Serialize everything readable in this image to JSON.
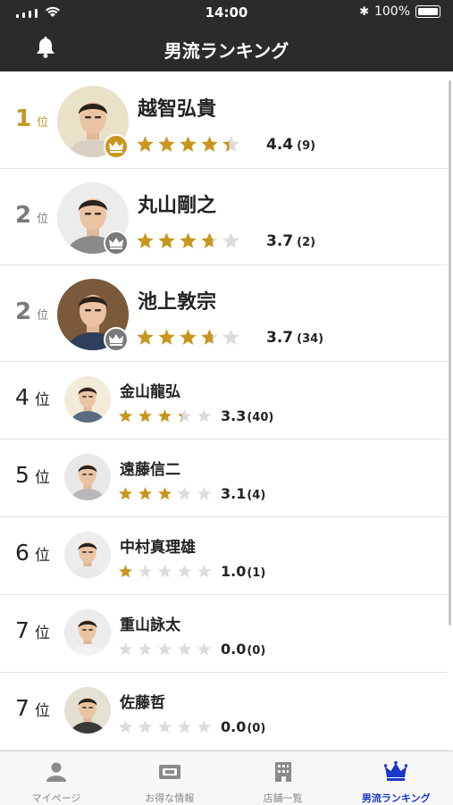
{
  "status": {
    "time": "14:00",
    "battery": "100%"
  },
  "header": {
    "title": "男流ランキング"
  },
  "rankings": [
    {
      "rank": "1",
      "unit": "位",
      "name": "越智弘貴",
      "rating": 4.4,
      "score": "4.4",
      "count": "(9)",
      "crown": "gold"
    },
    {
      "rank": "2",
      "unit": "位",
      "name": "丸山剛之",
      "rating": 3.7,
      "score": "3.7",
      "count": "(2)",
      "crown": "gray"
    },
    {
      "rank": "2",
      "unit": "位",
      "name": "池上敦宗",
      "rating": 3.7,
      "score": "3.7",
      "count": "(34)",
      "crown": "gray"
    },
    {
      "rank": "4",
      "unit": "位",
      "name": "金山龍弘",
      "rating": 3.3,
      "score": "3.3",
      "count": "(40)"
    },
    {
      "rank": "5",
      "unit": "位",
      "name": "遠藤信二",
      "rating": 3.1,
      "score": "3.1",
      "count": "(4)"
    },
    {
      "rank": "6",
      "unit": "位",
      "name": "中村真理雄",
      "rating": 1.0,
      "score": "1.0",
      "count": "(1)"
    },
    {
      "rank": "7",
      "unit": "位",
      "name": "重山詠太",
      "rating": 0.0,
      "score": "0.0",
      "count": "(0)"
    },
    {
      "rank": "7",
      "unit": "位",
      "name": "佐藤哲",
      "rating": 0.0,
      "score": "0.0",
      "count": "(0)"
    }
  ],
  "tabs": [
    {
      "label": "マイページ",
      "icon": "person-icon"
    },
    {
      "label": "お得な情報",
      "icon": "ticket-icon"
    },
    {
      "label": "店舗一覧",
      "icon": "building-icon"
    },
    {
      "label": "男流ランキング",
      "icon": "crown-icon",
      "active": true
    }
  ],
  "colors": {
    "gold": "#c8961e",
    "grayCrown": "#7a7a7a",
    "starEmpty": "#dcdcdc",
    "active": "#1a37c8",
    "rankGold": "#c8961e",
    "rankGray": "#7a7a7a"
  }
}
